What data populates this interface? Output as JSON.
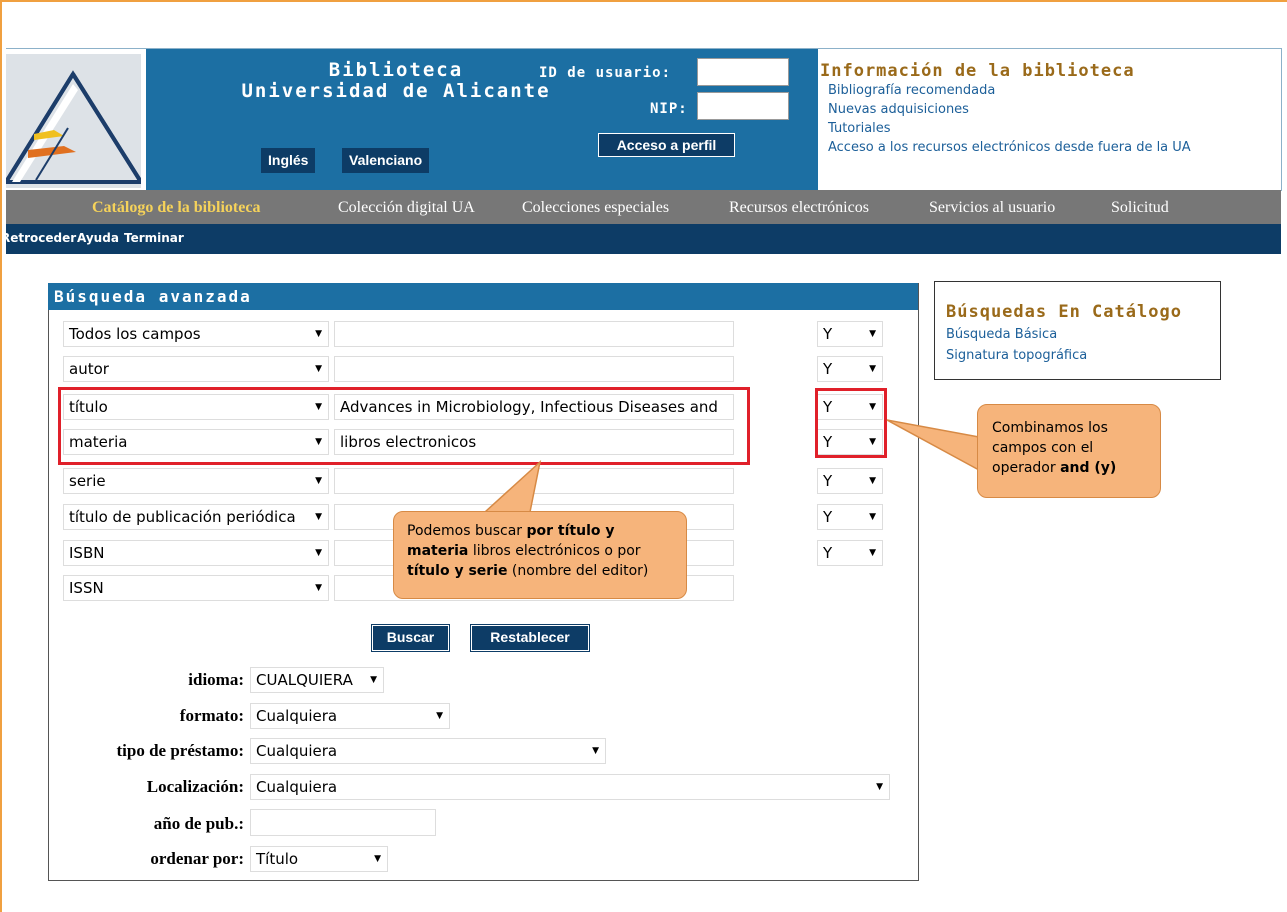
{
  "header": {
    "library_line1": "Biblioteca",
    "library_line2": "Universidad de Alicante",
    "user_id_label": "ID de usuario:",
    "nip_label": "NIP:",
    "profile_button": "Acceso a perfil",
    "lang_buttons": [
      "Inglés",
      "Valenciano"
    ],
    "info_title": "Información de la biblioteca",
    "info_links": [
      "Bibliografía recomendada",
      "Nuevas adquisiciones",
      "Tutoriales",
      "Acceso a los recursos electrónicos desde fuera de la UA"
    ]
  },
  "nav": {
    "primary": [
      "Catálogo de la biblioteca",
      "Colección digital UA",
      "Colecciones especiales",
      "Recursos electrónicos",
      "Servicios al usuario",
      "Solicitud"
    ],
    "secondary": [
      "Retroceder",
      "Ayuda",
      "Terminar"
    ]
  },
  "search": {
    "title": "Búsqueda avanzada",
    "rows": [
      {
        "field": "Todos los campos",
        "value": "",
        "op": "Y"
      },
      {
        "field": "autor",
        "value": "",
        "op": "Y"
      },
      {
        "field": "título",
        "value": "Advances in Microbiology, Infectious Diseases and",
        "op": "Y"
      },
      {
        "field": "materia",
        "value": "libros electronicos",
        "op": "Y"
      },
      {
        "field": "serie",
        "value": "",
        "op": "Y"
      },
      {
        "field": "título de publicación periódica",
        "value": "",
        "op": "Y"
      },
      {
        "field": "ISBN",
        "value": "",
        "op": "Y"
      },
      {
        "field": "ISSN",
        "value": "",
        "op": ""
      }
    ],
    "search_button": "Buscar",
    "reset_button": "Restablecer",
    "options": [
      {
        "label": "idioma:",
        "value": "CUALQUIERA"
      },
      {
        "label": "formato:",
        "value": "Cualquiera"
      },
      {
        "label": "tipo de préstamo:",
        "value": "Cualquiera"
      },
      {
        "label": "Localización:",
        "value": "Cualquiera"
      },
      {
        "label": "año de pub.:",
        "value": ""
      },
      {
        "label": "ordenar por:",
        "value": "Título"
      }
    ]
  },
  "catalog_box": {
    "title": "Búsquedas En Catálogo",
    "links": [
      "Búsqueda Básica",
      "Signatura topográfica"
    ]
  },
  "callouts": {
    "right": {
      "pre": "Combinamos los campos con el operador ",
      "bold": "and (y)"
    },
    "center": {
      "bold1": "por título y materia",
      "pre": "Podemos buscar ",
      "mid": " libros electrónicos o por ",
      "bold2": "título y serie",
      "post": " (nombre del editor)"
    }
  },
  "colors": {
    "blue": "#1c6fa3",
    "dark_blue": "#0d3c66",
    "red": "#e0202a",
    "callout": "#f6b47b"
  }
}
